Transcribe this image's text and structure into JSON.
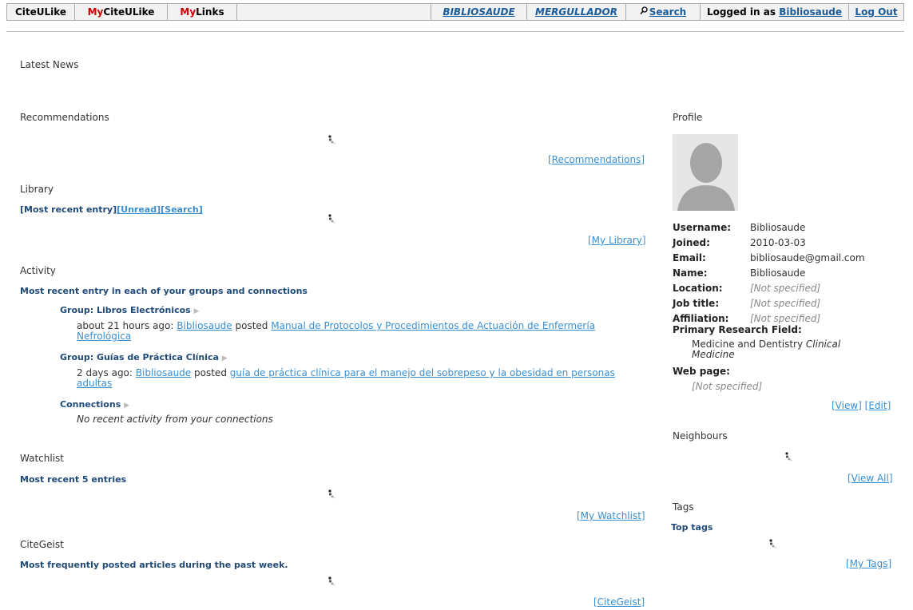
{
  "nav": {
    "citeulike": "CiteULike",
    "my_prefix": "My",
    "my_citeulike_rest": "CiteULike",
    "my_links_rest": "Links",
    "bibliosaude": "BIBLIOSAUDE",
    "mergullador": "MERGULLADOR",
    "search": "Search",
    "logged_in_as": "Logged in as",
    "username": "Bibliosaude",
    "logout": "Log Out"
  },
  "latest_news": {
    "title": "Latest News"
  },
  "recommendations": {
    "title": "Recommendations",
    "link": "[Recommendations]"
  },
  "library": {
    "title": "Library",
    "most_recent": "[Most recent entry]",
    "unread": "[Unread]",
    "search": "[Search]",
    "link": "[My Library]"
  },
  "activity": {
    "title": "Activity",
    "subtitle": "Most recent entry in each of your groups and connections",
    "groups": [
      {
        "name": "Group: Libros Electrónicos",
        "time": "about 21 hours ago:",
        "user": "Bibliosaude",
        "posted": "posted",
        "title_line1": "Manual de Protocolos y Procedimientos de Actuación de Enfermería",
        "title_line2": "Nefrológica"
      },
      {
        "name": "Group: Guías de Práctica Clínica",
        "time": "2 days ago:",
        "user": "Bibliosaude",
        "posted": "posted",
        "title_line1": "guía de práctica clínica para el manejo del sobrepeso y la obesidad en personas",
        "title_line2": "adultas"
      }
    ],
    "connections": "Connections",
    "no_activity": "No recent activity from your connections"
  },
  "watchlist": {
    "title": "Watchlist",
    "subtitle": "Most recent 5 entries",
    "link": "[My Watchlist]"
  },
  "citegeist": {
    "title": "CiteGeist",
    "subtitle": "Most frequently posted articles during the past week.",
    "link": "[CiteGeist]"
  },
  "profile": {
    "title": "Profile",
    "fields": [
      {
        "label": "Username:",
        "value": "Bibliosaude",
        "ns": false
      },
      {
        "label": "Joined:",
        "value": "2010-03-03",
        "ns": false
      },
      {
        "label": "Email:",
        "value": "bibliosaude@gmail.com",
        "ns": false
      },
      {
        "label": "Name:",
        "value": "Bibliosaude",
        "ns": false
      },
      {
        "label": "Location:",
        "value": "[Not specified]",
        "ns": true
      },
      {
        "label": "Job title:",
        "value": "[Not specified]",
        "ns": true
      },
      {
        "label": "Affiliation:",
        "value": "[Not specified]",
        "ns": true
      }
    ],
    "research_label": "Primary Research Field:",
    "research_value": "Medicine and Dentistry",
    "research_italic_1": "Clinical",
    "research_italic_2": "Medicine",
    "webpage_label": "Web page:",
    "webpage_value": "[Not specified]",
    "view": "[View]",
    "edit": "[Edit]"
  },
  "neighbours": {
    "title": "Neighbours",
    "link": "[View All]"
  },
  "tags": {
    "title": "Tags",
    "subtitle": "Top tags",
    "link": "[My Tags]"
  }
}
